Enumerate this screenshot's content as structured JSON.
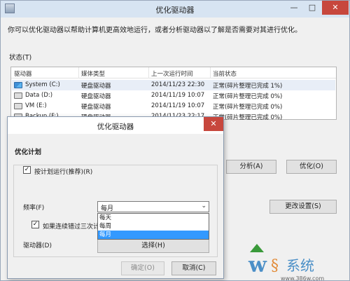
{
  "window": {
    "title": "优化驱动器"
  },
  "description": "你可以优化驱动器以帮助计算机更高效地运行，或者分析驱动器以了解是否需要对其进行优化。",
  "status_label": "状态(T)",
  "table": {
    "headers": [
      "驱动器",
      "媒体类型",
      "上一次运行时间",
      "当前状态"
    ],
    "rows": [
      {
        "drive": "System (C:)",
        "media": "硬盘驱动器",
        "time": "2014/11/23 22:30",
        "state": "正常(碎片整理已完成 1%)"
      },
      {
        "drive": "Data (D:)",
        "media": "硬盘驱动器",
        "time": "2014/11/19 10:07",
        "state": "正常(碎片整理已完成 0%)"
      },
      {
        "drive": "VM (E:)",
        "media": "硬盘驱动器",
        "time": "2014/11/19 10:07",
        "state": "正常(碎片整理已完成 0%)"
      },
      {
        "drive": "Backup (F:)",
        "media": "硬盘驱动器",
        "time": "2014/11/23 22:17",
        "state": "正常(碎片整理已完成 0%)"
      }
    ]
  },
  "buttons": {
    "analyze": "分析(A)",
    "optimize": "优化(O)",
    "change_settings": "更改设置(S)"
  },
  "dialog": {
    "title": "优化驱动器",
    "section_title": "优化计划",
    "schedule_label": "按计划运行(推荐)(R)",
    "frequency_label": "频率(F)",
    "frequency_value": "每月",
    "options": [
      "每天",
      "每周",
      "每月"
    ],
    "notify_label": "如果连续错过三次计",
    "drives_label": "驱动器(D)",
    "choose_button": "选择(H)",
    "ok_button": "确定(O)",
    "cancel_button": "取消(C)"
  },
  "watermark": {
    "text": "系统",
    "url": "www.386w.com"
  }
}
